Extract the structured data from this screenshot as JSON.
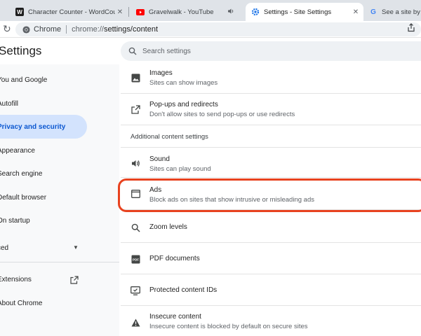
{
  "browser": {
    "tabs": [
      {
        "title": "Character Counter - WordCounter",
        "favicon": "wordcounter-favicon",
        "active": false
      },
      {
        "title": "Gravelwalk - YouTube",
        "favicon": "youtube-favicon",
        "active": false,
        "muted_icon": "speaker-icon"
      },
      {
        "title": "Settings - Site Settings",
        "favicon": "settings-gear-favicon",
        "active": true
      },
      {
        "title": "See a site by turning",
        "favicon": "google-favicon",
        "active": false
      }
    ],
    "omnibox": {
      "chip_label": "Chrome",
      "url": "chrome://settings/content",
      "url_scheme": "chrome://",
      "url_path": "settings/content"
    }
  },
  "settings": {
    "title": "Settings",
    "search_placeholder": "Search settings",
    "nav": [
      {
        "label": "You and Google",
        "active": false
      },
      {
        "label": "Autofill",
        "active": false
      },
      {
        "label": "Privacy and security",
        "active": true
      },
      {
        "label": "Appearance",
        "active": false
      },
      {
        "label": "Search engine",
        "active": false
      },
      {
        "label": "Default browser",
        "active": false
      },
      {
        "label": "On startup",
        "active": false
      },
      {
        "label": "ced",
        "active": false,
        "expandable": true
      },
      {
        "label": "Extensions",
        "active": false,
        "external": true
      },
      {
        "label": "About Chrome",
        "active": false
      }
    ],
    "content": {
      "images": {
        "title": "Images",
        "desc": "Sites can show images",
        "icon": "image-icon"
      },
      "popups": {
        "title": "Pop-ups and redirects",
        "desc": "Don't allow sites to send pop-ups or use redirects",
        "icon": "open-in-new-icon"
      },
      "section_label": "Additional content settings",
      "sound": {
        "title": "Sound",
        "desc": "Sites can play sound",
        "icon": "speaker-icon"
      },
      "ads": {
        "title": "Ads",
        "desc": "Block ads on sites that show intrusive or misleading ads",
        "icon": "ads-window-icon"
      },
      "zoom": {
        "title": "Zoom levels",
        "icon": "zoom-icon"
      },
      "pdf": {
        "title": "PDF documents",
        "icon": "pdf-icon"
      },
      "protected": {
        "title": "Protected content IDs",
        "icon": "protected-content-icon"
      },
      "insecure": {
        "title": "Insecure content",
        "desc": "Insecure content is blocked by default on secure sites",
        "icon": "warning-icon"
      }
    }
  },
  "colors": {
    "accent": "#0b57d0",
    "active_nav_bg": "#d3e3fd",
    "highlight_ring": "#e8421f"
  }
}
